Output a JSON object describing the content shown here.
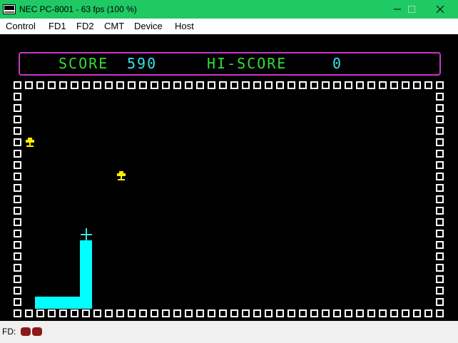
{
  "window": {
    "title": "NEC PC-8001 - 63 fps (100 %)",
    "icon": "computer-icon",
    "controls": [
      "minimize-icon",
      "maximize-icon",
      "close-icon"
    ]
  },
  "menu": {
    "items": [
      {
        "label": "Control"
      },
      {
        "label": "FD1"
      },
      {
        "label": "FD2"
      },
      {
        "label": "CMT"
      },
      {
        "label": "Device"
      },
      {
        "label": "Host"
      }
    ]
  },
  "game": {
    "score_label": "SCORE",
    "score": "590",
    "hiscore_label": "HI-SCORE",
    "hiscore": "0",
    "colors": {
      "hud_frame": "#cc33cc",
      "labels": "#33dd33",
      "values": "#33e6e6",
      "wall": "#ffffff",
      "snake": "#00ffff",
      "item": "#ffee00",
      "background": "#000000"
    },
    "item_icon": "spade-icon",
    "cursor_icon": "crosshair-icon"
  },
  "status": {
    "fd_label": "FD:",
    "led_color": "#8b1a1a",
    "led_count": 2
  }
}
